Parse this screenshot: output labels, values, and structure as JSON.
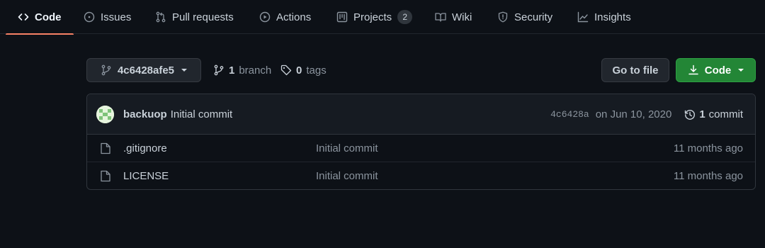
{
  "nav": {
    "tabs": [
      {
        "label": "Code",
        "icon": "code-icon",
        "selected": true
      },
      {
        "label": "Issues",
        "icon": "issue-opened-icon"
      },
      {
        "label": "Pull requests",
        "icon": "git-pull-request-icon"
      },
      {
        "label": "Actions",
        "icon": "play-icon"
      },
      {
        "label": "Projects",
        "icon": "project-icon",
        "counter": "2"
      },
      {
        "label": "Wiki",
        "icon": "book-icon"
      },
      {
        "label": "Security",
        "icon": "shield-icon"
      },
      {
        "label": "Insights",
        "icon": "graph-icon"
      }
    ],
    "accent": "#f78166"
  },
  "file_nav": {
    "branch": "4c6428afe5",
    "branch_count": "1",
    "branch_label": "branch",
    "tag_count": "0",
    "tag_label": "tags",
    "go_to_file": "Go to file",
    "code_button": "Code"
  },
  "latest_commit": {
    "author": "backuop",
    "message": "Initial commit",
    "sha": "4c6428a",
    "date": "on Jun 10, 2020",
    "commit_count": "1",
    "commit_label": "commit"
  },
  "files": [
    {
      "name": ".gitignore",
      "message": "Initial commit",
      "age": "11 months ago"
    },
    {
      "name": "LICENSE",
      "message": "Initial commit",
      "age": "11 months ago"
    }
  ],
  "colors": {
    "background": "#0d1117",
    "green_button": "#238636",
    "border": "#30363d"
  }
}
